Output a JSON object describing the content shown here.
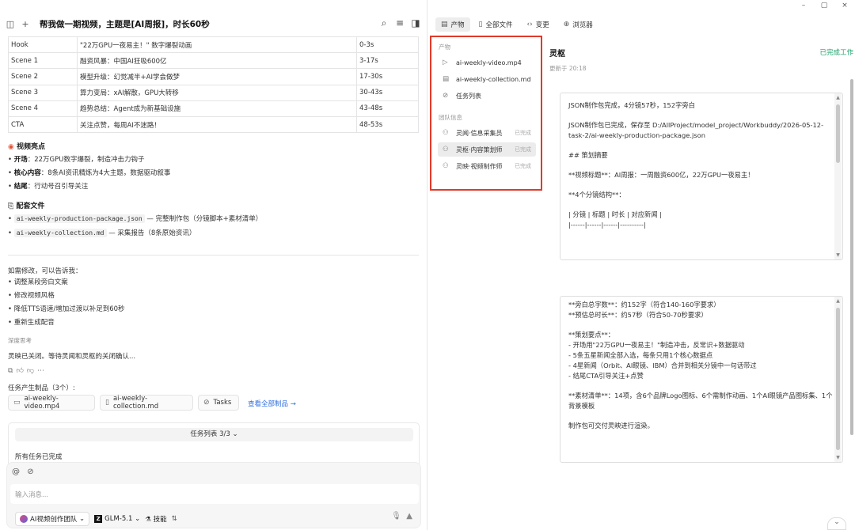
{
  "window": {
    "minimize": "–",
    "maximize": "▢",
    "close": "×"
  },
  "conversation": {
    "title": "帮我做一期视频，主题是[AI周报]，时长60秒"
  },
  "scene_table": [
    [
      "Hook",
      "\"22万GPU一夜易主！\" 数字爆裂动画",
      "0-3s"
    ],
    [
      "Scene 1",
      "融资风暴：中国AI狂吸600亿",
      "3-17s"
    ],
    [
      "Scene 2",
      "模型升级：幻觉减半+AI学会做梦",
      "17-30s"
    ],
    [
      "Scene 3",
      "算力变局：xAI解散，GPU大转移",
      "30-43s"
    ],
    [
      "Scene 4",
      "趋势总结：Agent成为新基础设施",
      "43-48s"
    ],
    [
      "CTA",
      "关注点赞，每周AI不迷路！",
      "48-53s"
    ]
  ],
  "highlights": {
    "title": "视频亮点",
    "items": [
      {
        "label": "开场",
        "text": "：22万GPU数字爆裂，制造冲击力钩子"
      },
      {
        "label": "核心内容",
        "text": "：8条AI资讯精炼为4大主题，数据驱动叙事"
      },
      {
        "label": "结尾",
        "text": "：行动号召引导关注"
      }
    ]
  },
  "files_section": {
    "title": "配套文件",
    "items": [
      {
        "name": "ai-weekly-production-package.json",
        "desc": " — 完整制作包（分镜脚本+素材清单）"
      },
      {
        "name": "ai-weekly-collection.md",
        "desc": " — 采集报告（8条原始资讯）"
      }
    ]
  },
  "modify": {
    "intro": "如需修改，可以告诉我：",
    "items": [
      "调整某段旁白文案",
      "修改视频风格",
      "降低TTS语速/增加过渡以补足到60秒",
      "重新生成配音"
    ]
  },
  "deep_think": {
    "label": "深度思考",
    "text": "灵映已关闭。等待灵闻和灵枢的关闭确认..."
  },
  "products": {
    "label": "任务产生制品（3个）:",
    "chips": [
      "ai-weekly-video.mp4",
      "ai-weekly-collection.md",
      "Tasks"
    ],
    "view_all": "查看全部制品 →"
  },
  "tasks": {
    "header": "任务列表 3/3",
    "status": "所有任务已完成"
  },
  "input": {
    "placeholder": "输入消息...",
    "team": "AI视频创作团队",
    "model": "GLM-5.1",
    "skills": "技能"
  },
  "right_tabs": [
    "产物",
    "全部文件",
    "变更",
    "浏览器"
  ],
  "sidebar": {
    "products_heading": "产物",
    "products": [
      "ai-weekly-video.mp4",
      "ai-weekly-collection.md",
      "任务列表"
    ],
    "team_heading": "团队信息",
    "team": [
      {
        "name": "灵闻·信息采集员",
        "status": "已完成"
      },
      {
        "name": "灵枢·内容策划师",
        "status": "已完成"
      },
      {
        "name": "灵映·视频制作师",
        "status": "已完成"
      }
    ]
  },
  "detail": {
    "title": "灵枢",
    "status": "已完成工作",
    "updated": "更新于 20:18",
    "card1": [
      "JSON制作包完成，4分镜57秒，152字旁白",
      "",
      "JSON制作包已完成，保存至 D:/AllProject/model_project/Workbuddy/2026-05-12-task-2/ai-weekly-production-package.json",
      "",
      "## 策划摘要",
      "",
      "**视频标题**：AI周报：一周融资600亿，22万GPU一夜易主！",
      "",
      "**4个分镜结构**：",
      "",
      "| 分镜 | 标题 | 时长 | 对应新闻 |",
      "|------|------|------|----------|"
    ],
    "card2": [
      "**旁白总字数**：约152字（符合140-160字要求）",
      "**预估总时长**：约57秒（符合50-70秒要求）",
      "",
      "**策划要点**：",
      "- 开场用\"22万GPU一夜易主！\"制造冲击，反常识+数据驱动",
      "- 5条五星新闻全部入选，每条只用1个核心数据点",
      "- 4星新闻（Orbit、AI眼镜、IBM）合并到相关分镜中一句话带过",
      "- 结尾CTA引导关注+点赞",
      "",
      "**素材清单**：14项，含6个品牌Logo图标、6个需制作动画、1个AI眼镜产品图标集、1个背景模板",
      "",
      "制作包可交付灵映进行渲染。"
    ]
  }
}
